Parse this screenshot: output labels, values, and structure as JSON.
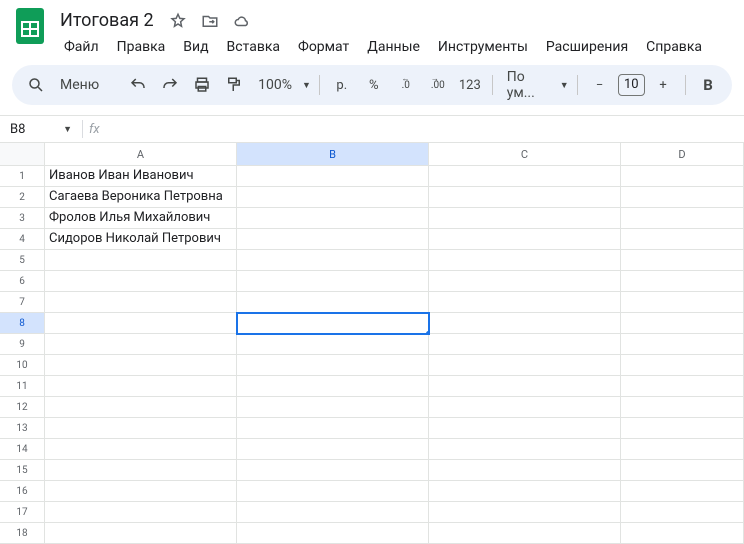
{
  "doc": {
    "title": "Итоговая 2"
  },
  "menus": {
    "file": "Файл",
    "edit": "Правка",
    "view": "Вид",
    "insert": "Вставка",
    "format": "Формат",
    "data": "Данные",
    "tools": "Инструменты",
    "extensions": "Расширения",
    "help": "Справка"
  },
  "toolbar": {
    "search_label": "Меню",
    "zoom": "100%",
    "currency": "р.",
    "percent": "%",
    "dec_less": ".0",
    "dec_more": ".00",
    "num_fmt": "123",
    "font": "По ум...",
    "font_size": "10",
    "minus": "−",
    "plus": "+",
    "bold": "B"
  },
  "namebox": {
    "ref": "B8"
  },
  "columns": [
    "A",
    "B",
    "C",
    "D"
  ],
  "selected": {
    "col": "B",
    "row": 8
  },
  "chart_data": {
    "type": "table",
    "columns": [
      "A",
      "B",
      "C",
      "D"
    ],
    "rows": [
      {
        "A": "Иванов Иван Иванович",
        "B": "",
        "C": "",
        "D": ""
      },
      {
        "A": "Сагаева Вероника Петровна",
        "B": "",
        "C": "",
        "D": ""
      },
      {
        "A": "Фролов Илья Михайлович",
        "B": "",
        "C": "",
        "D": ""
      },
      {
        "A": "Сидоров Николай Петрович",
        "B": "",
        "C": "",
        "D": ""
      },
      {
        "A": "",
        "B": "",
        "C": "",
        "D": ""
      },
      {
        "A": "",
        "B": "",
        "C": "",
        "D": ""
      },
      {
        "A": "",
        "B": "",
        "C": "",
        "D": ""
      },
      {
        "A": "",
        "B": "",
        "C": "",
        "D": ""
      },
      {
        "A": "",
        "B": "",
        "C": "",
        "D": ""
      },
      {
        "A": "",
        "B": "",
        "C": "",
        "D": ""
      },
      {
        "A": "",
        "B": "",
        "C": "",
        "D": ""
      },
      {
        "A": "",
        "B": "",
        "C": "",
        "D": ""
      },
      {
        "A": "",
        "B": "",
        "C": "",
        "D": ""
      },
      {
        "A": "",
        "B": "",
        "C": "",
        "D": ""
      },
      {
        "A": "",
        "B": "",
        "C": "",
        "D": ""
      },
      {
        "A": "",
        "B": "",
        "C": "",
        "D": ""
      },
      {
        "A": "",
        "B": "",
        "C": "",
        "D": ""
      },
      {
        "A": "",
        "B": "",
        "C": "",
        "D": ""
      }
    ]
  }
}
